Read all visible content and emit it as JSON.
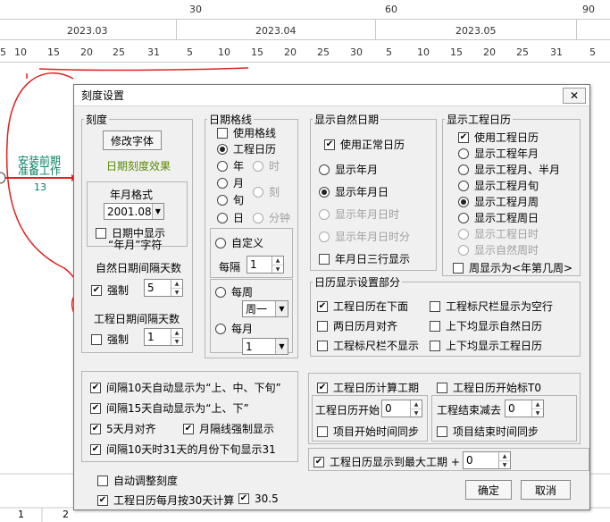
{
  "ruler": {
    "top_numbers": [
      "30",
      "60",
      "90"
    ],
    "months": [
      "2023.03",
      "2023.04",
      "2023.05"
    ],
    "days": [
      "5",
      "10",
      "15",
      "20",
      "25",
      "31",
      "5",
      "10",
      "15",
      "20",
      "25",
      "30",
      "5",
      "10",
      "15",
      "20",
      "25",
      "31",
      "5"
    ]
  },
  "task": {
    "label_line1": "安装前期",
    "label_line2": "准备工作",
    "duration": "13"
  },
  "bottom_ruler": {
    "labels": [
      "1",
      "2"
    ]
  },
  "dialog": {
    "title": "刻度设置",
    "close_glyph": "✕",
    "scale": {
      "legend": "刻度",
      "font_button": "修改字体",
      "effect_label": "日期刻度效果",
      "year_format_label": "年月格式",
      "year_format_value": "2001.08",
      "show_year_month_line1": "日期中显示",
      "show_year_month_line2": "“年月”字符",
      "natural_interval_label": "自然日期间隔天数",
      "force_label": "强制",
      "natural_interval_value": "5",
      "project_interval_label": "工程日期间隔天数",
      "force_label2": "强制",
      "project_interval_value": "1"
    },
    "date_grid": {
      "legend": "日期格线",
      "use_grid": "使用格线",
      "project_calendar": "工程日历",
      "year": "年",
      "hour": "时",
      "month": "月",
      "ten_days": "旬",
      "quarter": "刻",
      "day": "日",
      "minute": "分钟",
      "custom": "自定义",
      "every": "每隔",
      "every_value": "1",
      "weekly": "每周",
      "weekday_value": "周一",
      "monthly": "每月",
      "month_day_value": "1"
    },
    "natural_date": {
      "legend": "显示自然日期",
      "use_normal": "使用正常日历",
      "year_month": "显示年月",
      "year_month_day": "显示年月日",
      "ymd_hour": "显示年月日时",
      "ymd_hour_min": "显示年月日时分",
      "three_rows": "年月日三行显示"
    },
    "project_calendar": {
      "legend": "显示工程日历",
      "use_project": "使用工程日历",
      "project_ym": "显示工程年月",
      "project_ym_half": "显示工程月、半月",
      "project_ten_days": "显示工程月旬",
      "project_week": "显示工程月周",
      "project_week_day": "显示工程周日",
      "project_day_hour": "显示工程日时",
      "natural_week_hour": "显示自然周时",
      "week_format": "周显示为<年第几周>"
    },
    "calendar_display": {
      "legend": "日历显示设置部分",
      "project_below": "工程日历在下面",
      "ruler_blank": "工程标尺栏显示为空行",
      "align_two": "两日历月对齐",
      "both_natural": "上下均显示自然日历",
      "ruler_hidden": "工程标尺栏不显示",
      "both_project": "上下均显示工程日历"
    },
    "interval_options": {
      "auto_10": "间隔10天自动显示为“上、中、下旬”",
      "auto_15": "间隔15天自动显示为“上、下”",
      "five_day_align": "5天月对齐",
      "month_force": "月隔线强制显示",
      "show_31": "间隔10天时31天的月份下旬显示31"
    },
    "project_period": {
      "calc_period": "工程日历计算工期",
      "start_t0": "工程日历开始标T0",
      "start_label": "工程日历开始",
      "start_value": "0",
      "end_label": "工程结束减去",
      "end_value": "0",
      "sync_start": "项目开始时间同步",
      "sync_end": "项目结束时间同步"
    },
    "max_period": {
      "label": "工程日历显示到最大工期 +",
      "value": "0"
    },
    "auto_adjust": "自动调整刻度",
    "monthly_30": "工程日历每月按30天计算",
    "value_30_5": "30.5",
    "ok": "确定",
    "cancel": "取消"
  }
}
